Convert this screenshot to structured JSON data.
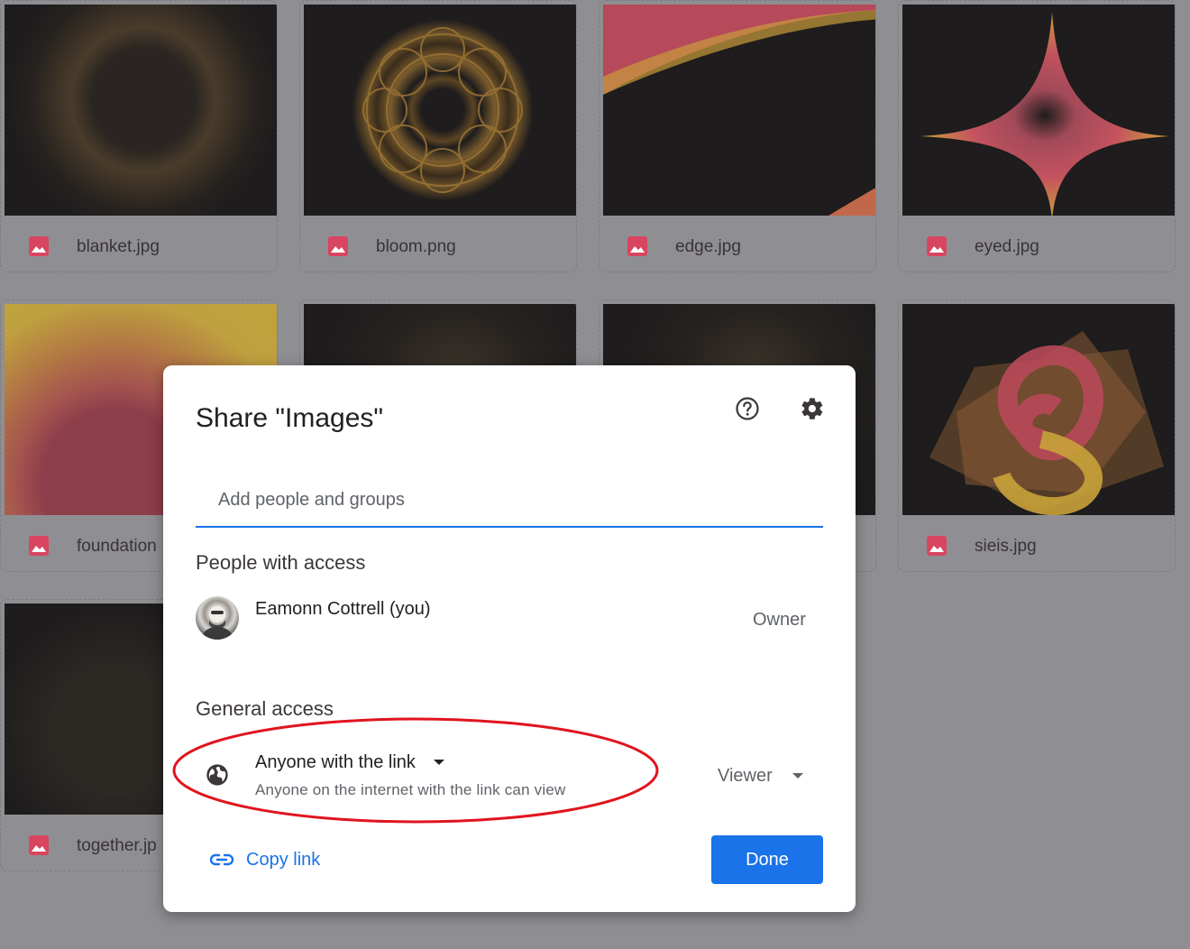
{
  "files": [
    {
      "name": "blanket.jpg"
    },
    {
      "name": "bloom.png"
    },
    {
      "name": "edge.jpg"
    },
    {
      "name": "eyed.jpg"
    },
    {
      "name": "foundation"
    },
    {
      "name": ""
    },
    {
      "name": ""
    },
    {
      "name": "sieis.jpg"
    },
    {
      "name": "together.jp"
    }
  ],
  "file_icon": "image-file-icon",
  "dialog": {
    "title": "Share \"Images\"",
    "help_icon": "help-circle-icon",
    "settings_icon": "gear-icon",
    "add_placeholder": "Add people and groups",
    "people_section_title": "People with access",
    "people": [
      {
        "name": "Eamonn Cottrell (you)",
        "role": "Owner"
      }
    ],
    "general_section_title": "General access",
    "access": {
      "icon": "globe-icon",
      "label": "Anyone with the link",
      "description": "Anyone on the internet with the link can view",
      "role": "Viewer"
    },
    "copy_link_icon": "link-icon",
    "copy_link_label": "Copy link",
    "done_label": "Done"
  },
  "colors": {
    "accent": "#1a73e8",
    "annotation_ellipse": "#e0141e",
    "file_icon": "#d9455f",
    "overlay": "#8f8f93"
  }
}
